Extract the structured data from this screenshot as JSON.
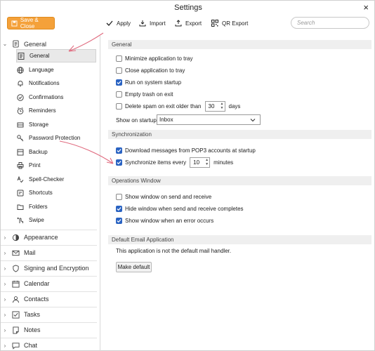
{
  "window": {
    "title": "Settings",
    "close_glyph": "×"
  },
  "toolbar": {
    "save_close": "Save & Close",
    "apply": "Apply",
    "import": "Import",
    "export": "Export",
    "qr_export": "QR Export",
    "search_placeholder": "Search",
    "accent": "#f4a13a"
  },
  "sidebar": {
    "general": {
      "label": "General",
      "chevron": "⌄",
      "items": [
        {
          "label": "General",
          "icon": "settings-list-icon"
        },
        {
          "label": "Language",
          "icon": "globe-icon"
        },
        {
          "label": "Notifications",
          "icon": "bell-icon"
        },
        {
          "label": "Confirmations",
          "icon": "check-circle-icon"
        },
        {
          "label": "Reminders",
          "icon": "reminder-clock-icon"
        },
        {
          "label": "Storage",
          "icon": "storage-icon"
        },
        {
          "label": "Password Protection",
          "icon": "key-icon"
        },
        {
          "label": "Backup",
          "icon": "backup-icon"
        },
        {
          "label": "Print",
          "icon": "printer-icon"
        },
        {
          "label": "Spell-Checker",
          "icon": "spell-check-icon"
        },
        {
          "label": "Shortcuts",
          "icon": "shortcuts-icon"
        },
        {
          "label": "Folders",
          "icon": "folder-icon"
        },
        {
          "label": "Swipe",
          "icon": "swipe-icon"
        }
      ]
    },
    "sections": [
      {
        "label": "Appearance",
        "icon": "appearance-icon",
        "chevron": "›"
      },
      {
        "label": "Mail",
        "icon": "mail-icon",
        "chevron": "›"
      },
      {
        "label": "Signing and Encryption",
        "icon": "shield-icon",
        "chevron": "›"
      },
      {
        "label": "Calendar",
        "icon": "calendar-icon",
        "chevron": "›"
      },
      {
        "label": "Contacts",
        "icon": "contacts-icon",
        "chevron": "›"
      },
      {
        "label": "Tasks",
        "icon": "tasks-icon",
        "chevron": "›"
      },
      {
        "label": "Notes",
        "icon": "notes-icon",
        "chevron": "›"
      },
      {
        "label": "Chat",
        "icon": "chat-icon",
        "chevron": "›"
      }
    ]
  },
  "main": {
    "general": {
      "header": "General",
      "minimize_tray": {
        "label": "Minimize application to tray",
        "checked": false
      },
      "close_tray": {
        "label": "Close application to tray",
        "checked": false
      },
      "run_startup": {
        "label": "Run on system startup",
        "checked": true
      },
      "empty_trash": {
        "label": "Empty trash on exit",
        "checked": false
      },
      "delete_spam": {
        "label": "Delete spam on exit older than",
        "checked": false,
        "value": "30",
        "unit": "days"
      },
      "show_on_startup": {
        "label": "Show on startup:",
        "value": "Inbox"
      }
    },
    "sync": {
      "header": "Synchronization",
      "download_pop3": {
        "label": "Download messages from POP3 accounts at startup",
        "checked": true
      },
      "sync_every": {
        "label": "Synchronize items every",
        "checked": true,
        "value": "10",
        "unit": "minutes"
      }
    },
    "ops": {
      "header": "Operations Window",
      "show_send_receive": {
        "label": "Show window on send and receive",
        "checked": false
      },
      "hide_complete": {
        "label": "Hide window when send and receive completes",
        "checked": true
      },
      "show_error": {
        "label": "Show window when an error occurs",
        "checked": true
      }
    },
    "default_email": {
      "header": "Default Email Application",
      "message": "This application is not the default mail handler.",
      "button": "Make default"
    }
  },
  "colors": {
    "checkbox_on": "#2a63c2",
    "annotation": "#e06b7f"
  }
}
